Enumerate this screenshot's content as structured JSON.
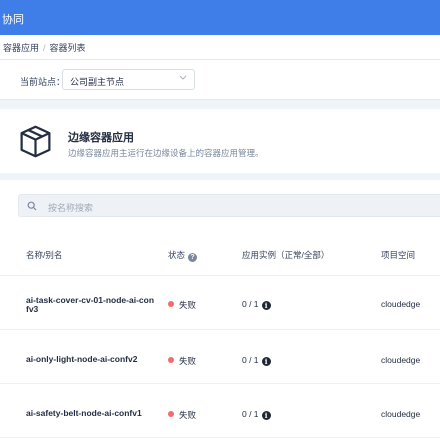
{
  "topbar": {
    "title": "协同"
  },
  "breadcrumb": {
    "items": [
      "容器应用",
      "容器列表"
    ]
  },
  "site": {
    "label": "当前站点：",
    "selected": "公司副主节点"
  },
  "hero": {
    "title": "边缘容器应用",
    "description": "边缘容器应用主运行在边缘设备上的容器应用管理。"
  },
  "search": {
    "placeholder": "按名称搜索"
  },
  "table": {
    "headers": {
      "name": "名称/别名",
      "status": "状态",
      "instances": "应用实例（正常/全部）",
      "project": "项目空间"
    },
    "rows": [
      {
        "name": "ai-task-cover-cv-01-node-ai-confv3",
        "status": "失败",
        "instances": "0 / 1",
        "project": "cloudedge"
      },
      {
        "name": "ai-only-light-node-ai-confv2",
        "status": "失败",
        "instances": "0 / 1",
        "project": "cloudedge"
      },
      {
        "name": "ai-safety-belt-node-ai-confv1",
        "status": "失败",
        "instances": "0 / 1",
        "project": "cloudedge"
      }
    ]
  },
  "colors": {
    "topbar": "#3f7ee8",
    "failed": "#f36c6c"
  },
  "icons": {
    "hero": "cube-icon",
    "search": "search-icon",
    "status_help": "question-circle-icon",
    "instance_info": "info-circle-icon",
    "select": "chevron-down-icon"
  }
}
